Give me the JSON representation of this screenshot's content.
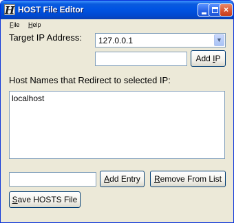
{
  "window": {
    "title": "HOST File Editor",
    "icon": "app-h-icon"
  },
  "titlebar_buttons": {
    "minimize": "minimize-icon",
    "maximize": "maximize-icon",
    "close": "×"
  },
  "menu": {
    "file": {
      "mnemonic": "F",
      "rest": "ile"
    },
    "help": {
      "mnemonic": "H",
      "rest": "elp"
    }
  },
  "labels": {
    "target_ip": "Target IP Address:",
    "hosts_redirect": "Host Names that Redirect to selected IP:"
  },
  "target_ip_select": {
    "value": "127.0.0.1",
    "arrow": "▼"
  },
  "new_ip_input": {
    "value": ""
  },
  "buttons": {
    "add_ip": {
      "pre": "Add ",
      "mnemonic": "I",
      "post": "P"
    },
    "add_entry": {
      "pre": "",
      "mnemonic": "A",
      "post": "dd Entry"
    },
    "remove": {
      "pre": "",
      "mnemonic": "R",
      "post": "emove From List"
    },
    "save": {
      "pre": "",
      "mnemonic": "S",
      "post": "ave HOSTS File"
    }
  },
  "host_list": {
    "items": [
      "localhost"
    ]
  },
  "new_entry_input": {
    "value": ""
  },
  "colors": {
    "titlebar": "#0054e3",
    "window_bg": "#ece9d8",
    "field_border": "#7f9db9",
    "button_border": "#003c74"
  }
}
